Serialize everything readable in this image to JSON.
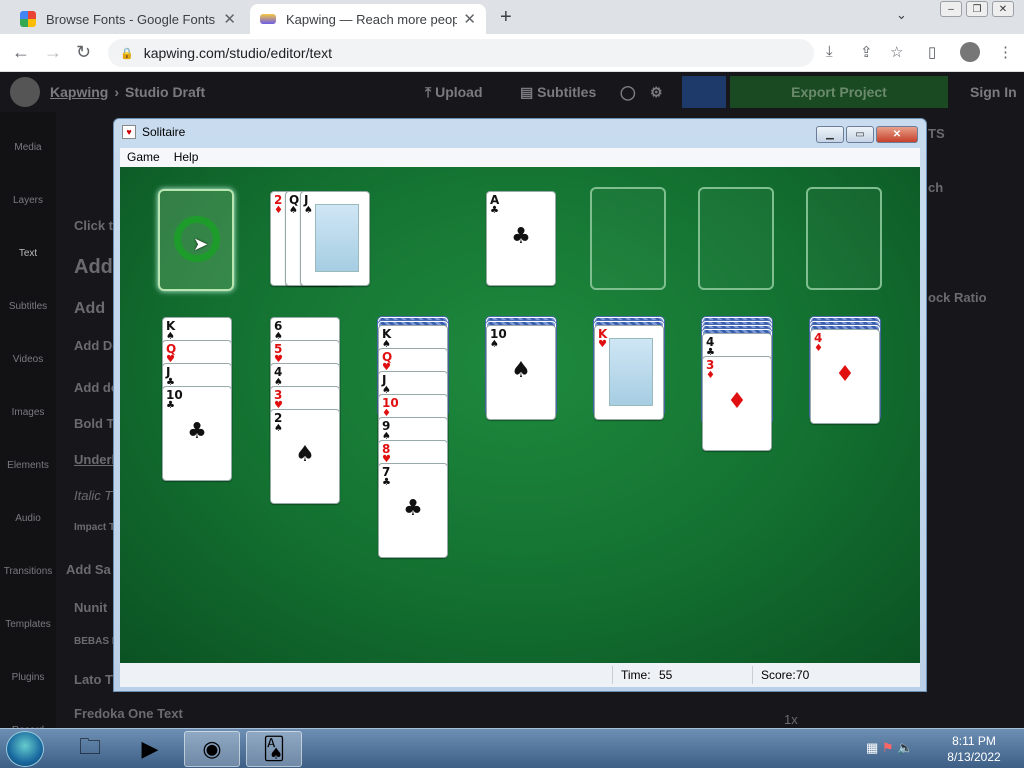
{
  "browser": {
    "tabs": [
      {
        "title": "Browse Fonts - Google Fonts",
        "active": false
      },
      {
        "title": "Kapwing — Reach more people with your videos",
        "active": true
      }
    ],
    "url": "kapwing.com/studio/editor/text"
  },
  "kapwing": {
    "brand": "Kapwing",
    "draft": "Studio Draft",
    "upload": "Upload",
    "subtitles": "Subtitles",
    "export": "Export Project",
    "signin": "Sign In",
    "sidebar": [
      "Media",
      "Layers",
      "Text",
      "Subtitles",
      "Videos",
      "Images",
      "Elements",
      "Audio",
      "Transitions",
      "Templates",
      "Plugins",
      "Record"
    ],
    "panel": [
      "Click to",
      "Add",
      "Add",
      "Add De",
      "Add dec",
      "Bold T",
      "Underl",
      "Italic T",
      "Impact T",
      "Add Sa",
      "Nunit",
      "BEBAS N",
      "Lato T",
      "Fredoka One Text"
    ],
    "right": [
      "TS",
      "ch",
      "ock Ratio",
      "1x"
    ]
  },
  "solitaire": {
    "title": "Solitaire",
    "menu": [
      "Game",
      "Help"
    ],
    "status": {
      "time_label": "Time:",
      "time": "55",
      "score_label": "Score:",
      "score": "70"
    },
    "waste": [
      {
        "rank": "2",
        "suit": "♦"
      },
      {
        "rank": "Q",
        "suit": "♠"
      },
      {
        "rank": "J",
        "suit": "♠"
      }
    ],
    "foundations": [
      {
        "rank": "A",
        "suit": "♣"
      }
    ],
    "tableau": [
      {
        "hidden": 0,
        "cards": [
          {
            "rank": "K",
            "suit": "♠"
          },
          {
            "rank": "Q",
            "suit": "♥"
          },
          {
            "rank": "J",
            "suit": "♣"
          },
          {
            "rank": "10",
            "suit": "♣"
          }
        ]
      },
      {
        "hidden": 0,
        "cards": [
          {
            "rank": "6",
            "suit": "♠"
          },
          {
            "rank": "5",
            "suit": "♥"
          },
          {
            "rank": "4",
            "suit": "♠"
          },
          {
            "rank": "3",
            "suit": "♥"
          },
          {
            "rank": "2",
            "suit": "♠"
          }
        ]
      },
      {
        "hidden": 2,
        "cards": [
          {
            "rank": "K",
            "suit": "♠"
          },
          {
            "rank": "Q",
            "suit": "♥"
          },
          {
            "rank": "J",
            "suit": "♠"
          },
          {
            "rank": "10",
            "suit": "♦"
          },
          {
            "rank": "9",
            "suit": "♠"
          },
          {
            "rank": "8",
            "suit": "♥"
          },
          {
            "rank": "7",
            "suit": "♣"
          }
        ]
      },
      {
        "hidden": 2,
        "cards": [
          {
            "rank": "10",
            "suit": "♠"
          }
        ]
      },
      {
        "hidden": 2,
        "cards": [
          {
            "rank": "K",
            "suit": "♥"
          }
        ]
      },
      {
        "hidden": 4,
        "cards": [
          {
            "rank": "4",
            "suit": "♣"
          },
          {
            "rank": "3",
            "suit": "♦"
          }
        ]
      },
      {
        "hidden": 3,
        "cards": [
          {
            "rank": "4",
            "suit": "♦"
          }
        ]
      }
    ]
  },
  "taskbar": {
    "clock_time": "8:11 PM",
    "clock_date": "8/13/2022"
  }
}
